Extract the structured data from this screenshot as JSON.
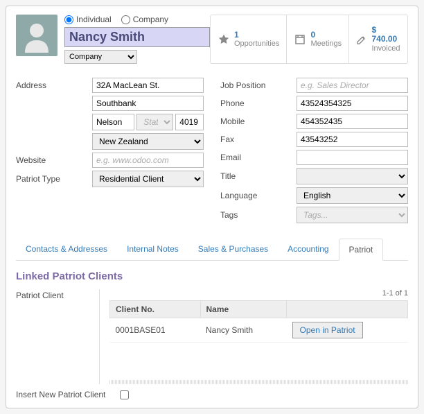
{
  "type_radio": {
    "individual": "Individual",
    "company": "Company",
    "selected": "individual"
  },
  "name": "Nancy Smith",
  "company_select_placeholder": "Company",
  "stats": {
    "opportunities": {
      "count": "1",
      "label": "Opportunities"
    },
    "meetings": {
      "count": "0",
      "label": "Meetings"
    },
    "invoiced": {
      "amount": "$ 740.00",
      "label": "Invoiced"
    }
  },
  "labels": {
    "address": "Address",
    "website": "Website",
    "patriot_type": "Patriot Type",
    "job_position": "Job Position",
    "phone": "Phone",
    "mobile": "Mobile",
    "fax": "Fax",
    "email": "Email",
    "title": "Title",
    "language": "Language",
    "tags": "Tags"
  },
  "address": {
    "street": "32A MacLean St.",
    "street2": "Southbank",
    "city": "Nelson",
    "state_placeholder": "State",
    "zip": "4019",
    "country": "New Zealand"
  },
  "website_placeholder": "e.g. www.odoo.com",
  "patriot_type": "Residential Client",
  "job_position_placeholder": "e.g. Sales Director",
  "phone": "43524354325",
  "mobile": "454352435",
  "fax": "43543252",
  "email": "",
  "title": "",
  "language": "English",
  "tags_placeholder": "Tags...",
  "tabs": {
    "contacts": "Contacts & Addresses",
    "notes": "Internal Notes",
    "sales": "Sales & Purchases",
    "accounting": "Accounting",
    "patriot": "Patriot"
  },
  "linked": {
    "title": "Linked Patriot Clients",
    "label": "Patriot Client",
    "count": "1-1 of 1",
    "headers": {
      "no": "Client No.",
      "name": "Name"
    },
    "rows": [
      {
        "no": "0001BASE01",
        "name": "Nancy Smith",
        "button": "Open in Patriot"
      }
    ],
    "insert_label": "Insert New Patriot Client"
  }
}
